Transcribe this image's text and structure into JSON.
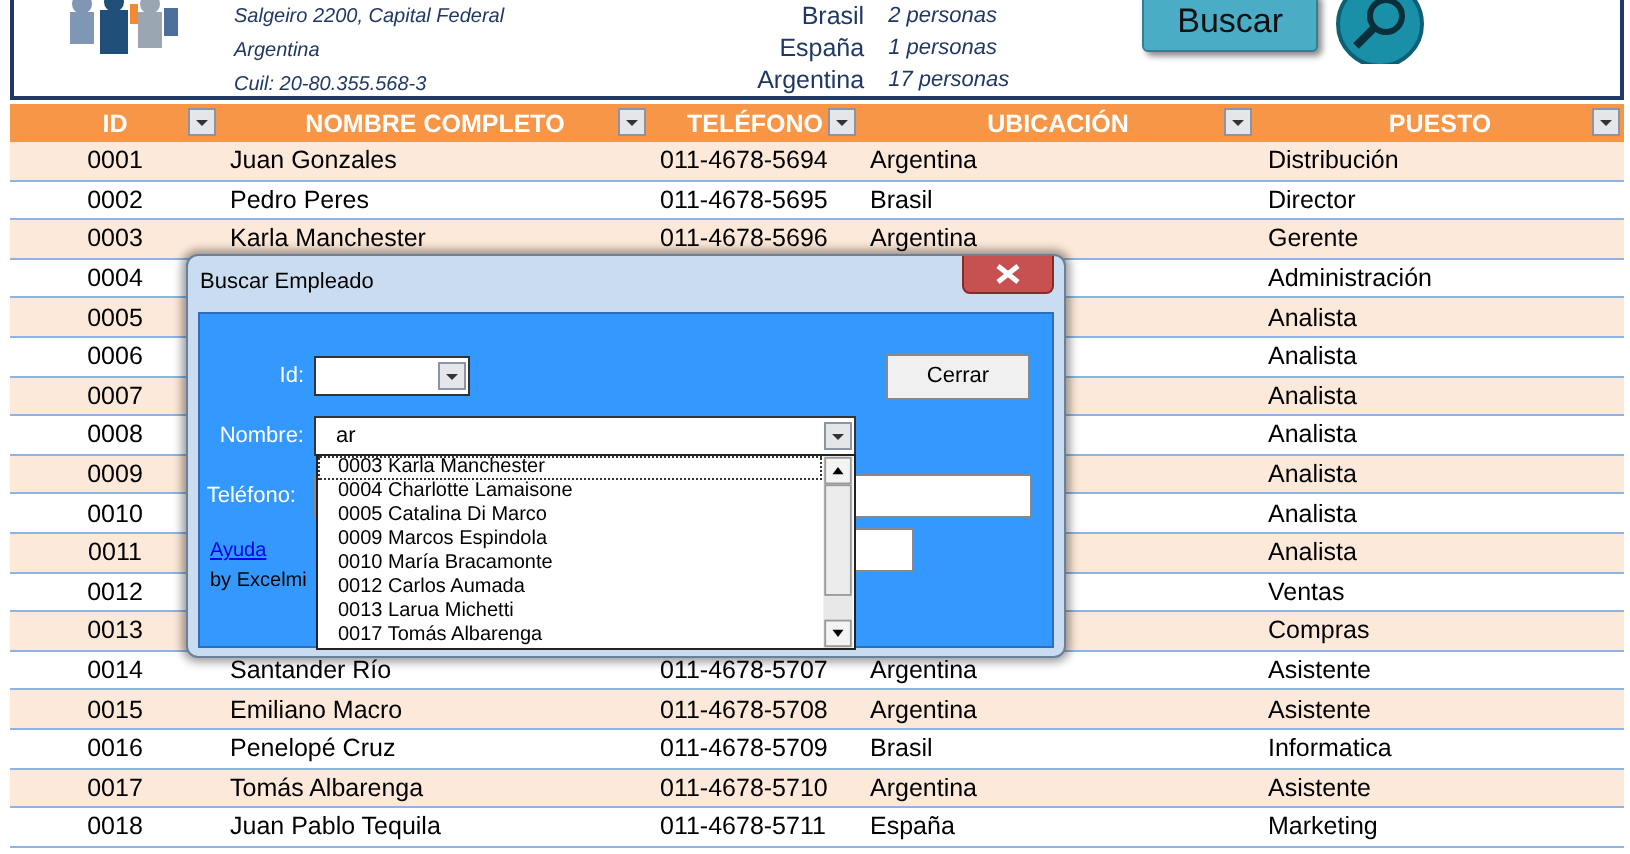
{
  "company": {
    "lines": [
      "Salgeiro 2200, Capital Federal",
      "Argentina",
      "Cuil: 20-80.355.568-3"
    ]
  },
  "country_counts": [
    {
      "country": "Brasil",
      "count": "2 personas"
    },
    {
      "country": "España",
      "count": "1 personas"
    },
    {
      "country": "Argentina",
      "count": "17 personas"
    }
  ],
  "search_button": "Buscar",
  "table": {
    "columns": [
      "ID",
      "NOMBRE COMPLETO",
      "TELÉFONO",
      "UBICACIÓN",
      "PUESTO"
    ],
    "rows": [
      {
        "id": "0001",
        "name": "Juan Gonzales",
        "phone": "011-4678-5694",
        "location": "Argentina",
        "position": "Distribución"
      },
      {
        "id": "0002",
        "name": "Pedro Peres",
        "phone": "011-4678-5695",
        "location": "Brasil",
        "position": "Director"
      },
      {
        "id": "0003",
        "name": "Karla Manchester",
        "phone": "011-4678-5696",
        "location": "Argentina",
        "position": "Gerente"
      },
      {
        "id": "0004",
        "position": "Administración"
      },
      {
        "id": "0005",
        "position": "Analista"
      },
      {
        "id": "0006",
        "position": "Analista"
      },
      {
        "id": "0007",
        "position": "Analista"
      },
      {
        "id": "0008",
        "position": "Analista"
      },
      {
        "id": "0009",
        "position": "Analista"
      },
      {
        "id": "0010",
        "position": "Analista"
      },
      {
        "id": "0011",
        "position": "Analista"
      },
      {
        "id": "0012",
        "position": "Ventas"
      },
      {
        "id": "0013",
        "position": "Compras"
      },
      {
        "id": "0014",
        "name": "Santander Río",
        "phone": "011-4678-5707",
        "location": "Argentina",
        "position": "Asistente"
      },
      {
        "id": "0015",
        "name": "Emiliano Macro",
        "phone": "011-4678-5708",
        "location": "Argentina",
        "position": "Asistente"
      },
      {
        "id": "0016",
        "name": "Penelopé Cruz",
        "phone": "011-4678-5709",
        "location": "Brasil",
        "position": "Informatica"
      },
      {
        "id": "0017",
        "name": "Tomás Albarenga",
        "phone": "011-4678-5710",
        "location": "Argentina",
        "position": "Asistente"
      },
      {
        "id": "0018",
        "name": "Juan Pablo Tequila",
        "phone": "011-4678-5711",
        "location": "España",
        "position": "Marketing"
      }
    ]
  },
  "dialog": {
    "title": "Buscar Empleado",
    "id_label": "Id:",
    "name_label": "Nombre:",
    "name_value": "ar",
    "phone_label": "Teléfono:",
    "close_button": "Cerrar",
    "help_link": "Ayuda",
    "credit": "by Excelmi",
    "suggestions": [
      {
        "label": "0003 Karla Manchester",
        "selected": true
      },
      {
        "label": "0004 Charlotte Lamaisone",
        "selected": false
      },
      {
        "label": "0005 Catalina Di Marco",
        "selected": false
      },
      {
        "label": "0009 Marcos Espindola",
        "selected": false
      },
      {
        "label": "0010 María Bracamonte",
        "selected": false
      },
      {
        "label": "0012 Carlos Aumada",
        "selected": false
      },
      {
        "label": "0013 Larua Michetti",
        "selected": false
      },
      {
        "label": "0017 Tomás Albarenga",
        "selected": false
      }
    ]
  }
}
